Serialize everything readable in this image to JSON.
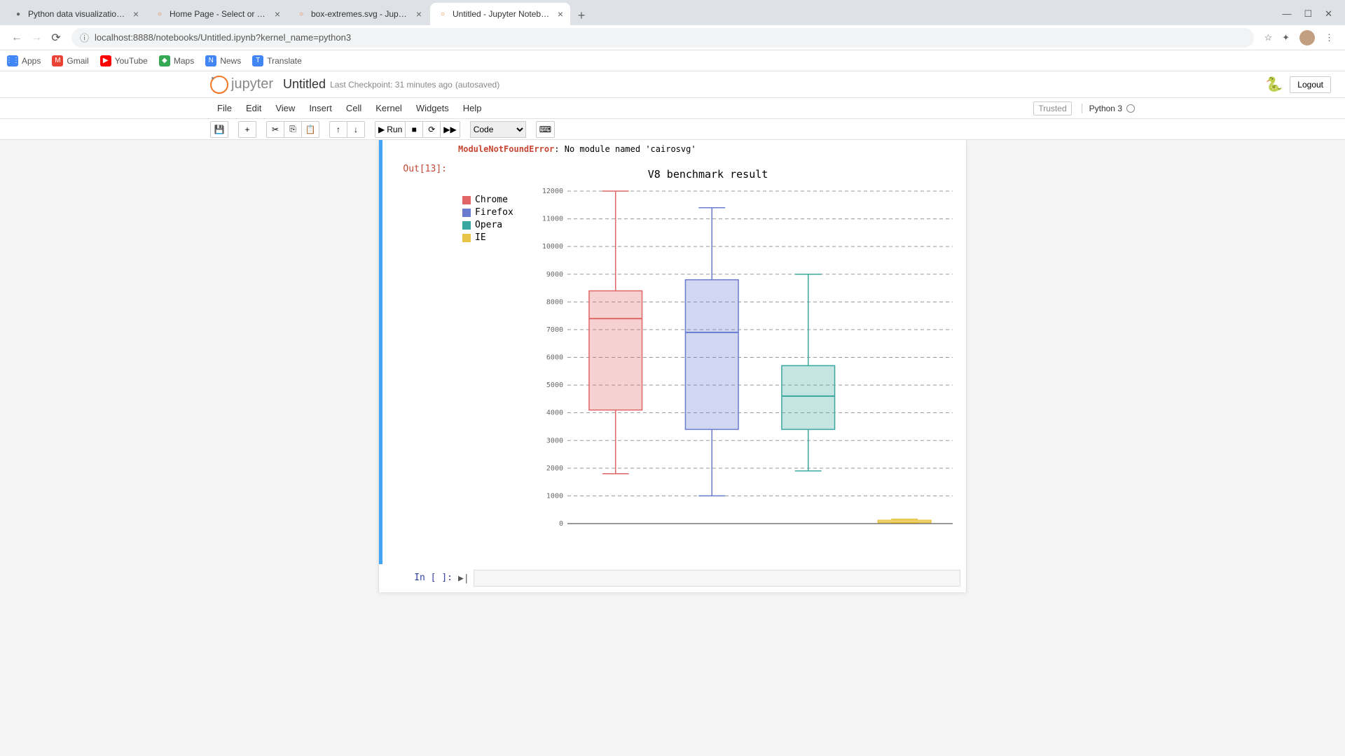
{
  "browser": {
    "tabs": [
      {
        "title": "Python data visualization (Pygal",
        "favicon_bg": "#666",
        "favicon_char": "●"
      },
      {
        "title": "Home Page - Select or create a n",
        "favicon_bg": "#f37626",
        "favicon_char": "○"
      },
      {
        "title": "box-extremes.svg - Jupyter Text",
        "favicon_bg": "#f37626",
        "favicon_char": "○"
      },
      {
        "title": "Untitled - Jupyter Notebook",
        "favicon_bg": "#f37626",
        "favicon_char": "○"
      }
    ],
    "url": "localhost:8888/notebooks/Untitled.ipynb?kernel_name=python3",
    "bookmarks": [
      {
        "label": "Apps",
        "bg": "#4285f4",
        "char": "⋮⋮"
      },
      {
        "label": "Gmail",
        "bg": "#ea4335",
        "char": "M"
      },
      {
        "label": "YouTube",
        "bg": "#ff0000",
        "char": "▶"
      },
      {
        "label": "Maps",
        "bg": "#34a853",
        "char": "◆"
      },
      {
        "label": "News",
        "bg": "#4285f4",
        "char": "N"
      },
      {
        "label": "Translate",
        "bg": "#4285f4",
        "char": "T"
      }
    ]
  },
  "jupyter": {
    "logo_text": "jupyter",
    "nb_title": "Untitled",
    "checkpoint": "Last Checkpoint: 31 minutes ago",
    "autosaved": "(autosaved)",
    "logout": "Logout",
    "menus": [
      "File",
      "Edit",
      "View",
      "Insert",
      "Cell",
      "Kernel",
      "Widgets",
      "Help"
    ],
    "trusted": "Trusted",
    "kernel": "Python 3",
    "run_label": "Run",
    "celltype": "Code",
    "out_prompt": "Out[13]:",
    "in_prompt": "In [ ]:",
    "error_name": "ModuleNotFoundError",
    "error_msg": ": No module named 'cairosvg'"
  },
  "chart_data": {
    "type": "boxplot",
    "title": "V8 benchmark result",
    "ylabel": "",
    "xlabel": "",
    "ylim": [
      0,
      12000
    ],
    "yticks": [
      0,
      1000,
      2000,
      3000,
      4000,
      5000,
      6000,
      7000,
      8000,
      9000,
      10000,
      11000,
      12000
    ],
    "series": [
      {
        "name": "Chrome",
        "color": "#e06666",
        "min": 1800,
        "q1": 4100,
        "median": 7400,
        "q3": 8400,
        "max": 12000
      },
      {
        "name": "Firefox",
        "color": "#6a7bcf",
        "min": 1000,
        "q1": 3400,
        "median": 6900,
        "q3": 8800,
        "max": 11400
      },
      {
        "name": "Opera",
        "color": "#3aa89e",
        "min": 1900,
        "q1": 3400,
        "median": 4600,
        "q3": 5700,
        "max": 9000
      },
      {
        "name": "IE",
        "color": "#e8c547",
        "min": 30,
        "q1": 40,
        "median": 60,
        "q3": 120,
        "max": 160
      }
    ]
  }
}
